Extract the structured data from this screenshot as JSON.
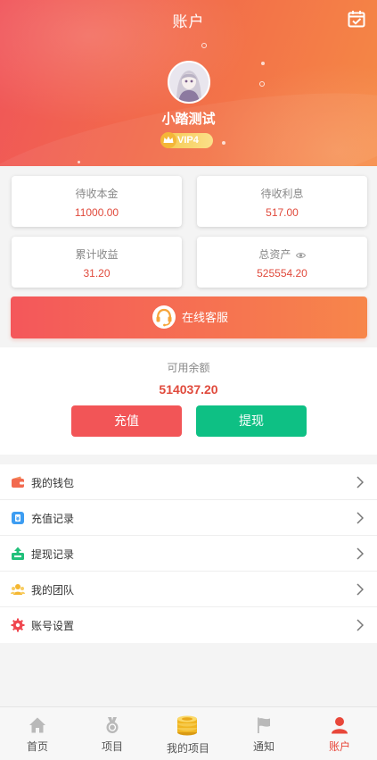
{
  "header": {
    "title": "账户",
    "calendar_icon": "calendar-check-icon",
    "username": "小踏测试",
    "vip_label": "VIP4",
    "avatar_icon": "user-avatar"
  },
  "stats": [
    {
      "label": "待收本金",
      "value": "11000.00"
    },
    {
      "label": "待收利息",
      "value": "517.00"
    },
    {
      "label": "累计收益",
      "value": "31.20"
    },
    {
      "label": "总资产",
      "value": "525554.20",
      "icon": "eye-icon"
    }
  ],
  "service": {
    "label": "在线客服",
    "icon": "headset-icon"
  },
  "balance": {
    "label": "可用余额",
    "value": "514037.20",
    "recharge_label": "充值",
    "withdraw_label": "提现"
  },
  "menu": [
    {
      "label": "我的钱包",
      "icon": "wallet-icon",
      "color": "#f26a4f"
    },
    {
      "label": "充值记录",
      "icon": "recharge-record-icon",
      "color": "#3d9df2"
    },
    {
      "label": "提现记录",
      "icon": "withdraw-record-icon",
      "color": "#21c07a"
    },
    {
      "label": "我的团队",
      "icon": "team-icon",
      "color": "#f5b731"
    },
    {
      "label": "账号设置",
      "icon": "settings-icon",
      "color": "#f0474f"
    }
  ],
  "tabbar": [
    {
      "label": "首页",
      "icon": "home-icon"
    },
    {
      "label": "项目",
      "icon": "medal-icon"
    },
    {
      "label": "我的项目",
      "icon": "coins-icon"
    },
    {
      "label": "通知",
      "icon": "flag-icon"
    },
    {
      "label": "账户",
      "icon": "user-icon",
      "active": true
    }
  ],
  "colors": {
    "accent_red": "#e04a3c",
    "recharge_button": "#f25557",
    "withdraw_button": "#0ec084",
    "active_tab": "#e8473a"
  }
}
